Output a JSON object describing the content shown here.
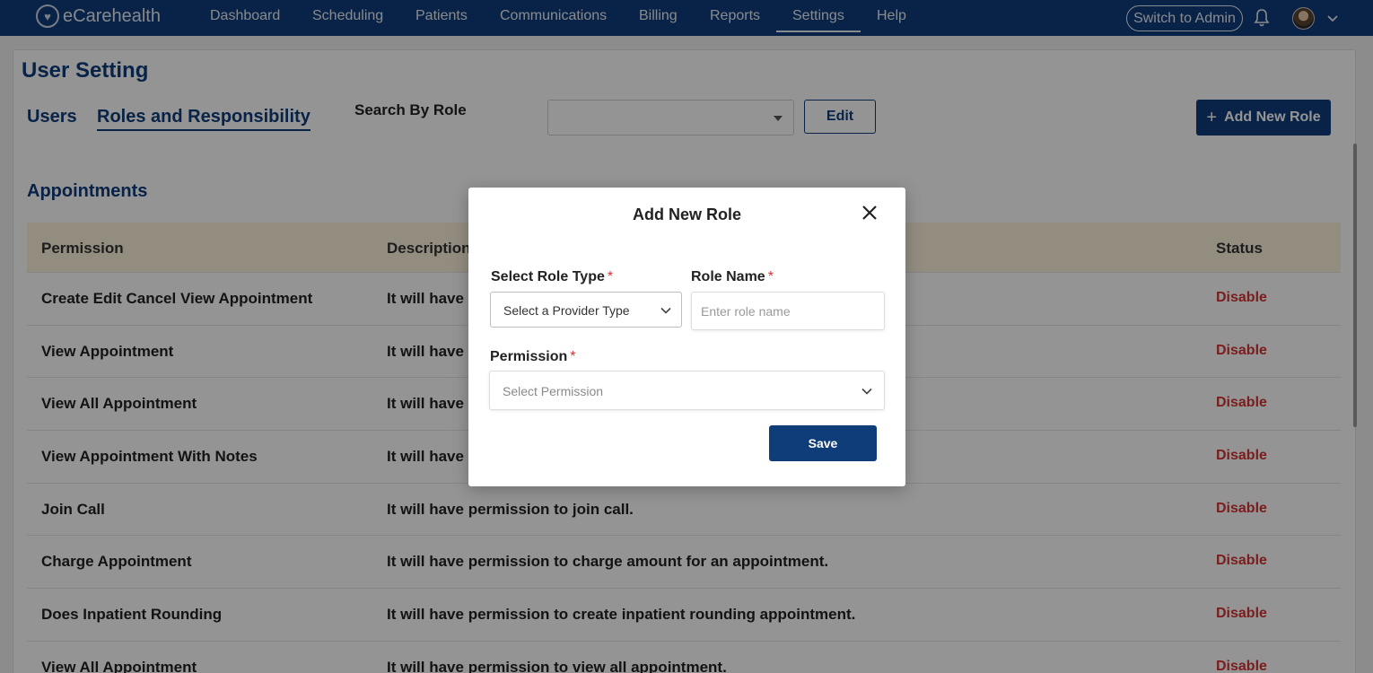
{
  "app": {
    "brand": "eCarehealth",
    "nav": [
      "Dashboard",
      "Scheduling",
      "Patients",
      "Communications",
      "Billing",
      "Reports",
      "Settings",
      "Help"
    ],
    "active_nav": "Settings",
    "switch_label": "Switch to Admin"
  },
  "page": {
    "title": "User Setting",
    "tabs": [
      "Users",
      "Roles and Responsibility"
    ],
    "active_tab": "Roles and Responsibility",
    "search_label": "Search By Role",
    "search_value": "",
    "edit_label": "Edit",
    "add_role_label": "Add New Role",
    "section_title": "Appointments",
    "table": {
      "headers": [
        "Permission",
        "Description",
        "Status"
      ],
      "rows": [
        {
          "permission": "Create Edit Cancel View Appointment",
          "description": "It will have permission to create, edit, cancel and view appointment.",
          "status": "Disable"
        },
        {
          "permission": "View Appointment",
          "description": "It will have permission to view appointment.",
          "status": "Disable"
        },
        {
          "permission": "View All Appointment",
          "description": "It will have permission to view all appointment.",
          "status": "Disable"
        },
        {
          "permission": "View Appointment With Notes",
          "description": "It will have permission to view appointment with notes.",
          "status": "Disable"
        },
        {
          "permission": "Join Call",
          "description": "It will have permission to join call.",
          "status": "Disable"
        },
        {
          "permission": "Charge Appointment",
          "description": "It will have permission to charge amount for an appointment.",
          "status": "Disable"
        },
        {
          "permission": "Does Inpatient Rounding",
          "description": "It will have permission to create inpatient rounding appointment.",
          "status": "Disable"
        },
        {
          "permission": "View All Appointment",
          "description": "It will have permission to view all appointment.",
          "status": "Disable"
        }
      ]
    }
  },
  "modal": {
    "title": "Add New Role",
    "role_type_label": "Select Role Type",
    "role_type_value": "Select a Provider Type",
    "role_name_label": "Role Name",
    "role_name_placeholder": "Enter role name",
    "permission_label": "Permission",
    "permission_placeholder": "Select Permission",
    "required_mark": "*",
    "save_label": "Save"
  },
  "colors": {
    "primary": "#0f3d7a",
    "danger": "#d63333",
    "table_header_bg": "#fdf3dc"
  }
}
